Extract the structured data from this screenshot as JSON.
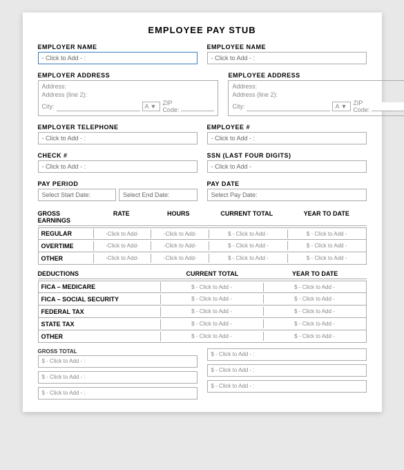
{
  "title": "EMPLOYEE PAY STUB",
  "employer": {
    "name_label": "EMPLOYER NAME",
    "name_placeholder": "- Click to Add - :",
    "address_label": "EMPLOYER ADDRESS",
    "address_line1": "Address:",
    "address_line2": "Address (line 2):",
    "city_label": "City:",
    "state_default": "A",
    "zip_label": "ZIP Code:",
    "telephone_label": "EMPLOYER TELEPHONE",
    "telephone_placeholder": "- Click to Add - :"
  },
  "employee": {
    "name_label": "EMPLOYEE NAME",
    "name_placeholder": "- Click to Add - :",
    "address_label": "EMPLOYEE ADDRESS",
    "address_line1": "Address:",
    "address_line2": "Address (line 2):",
    "city_label": "City:",
    "state_default": "A",
    "zip_label": "ZIP Code:",
    "number_label": "EMPLOYEE #",
    "number_placeholder": "- Click to Add - :",
    "ssn_label": "SSN (LAST FOUR DIGITS)",
    "ssn_placeholder": "- Click to Add -"
  },
  "check_label": "CHECK #",
  "check_placeholder": "- Click to Add - :",
  "pay_period_label": "PAY PERIOD",
  "pay_period_start": "Select Start Date:",
  "pay_period_end": "Select End Date:",
  "pay_date_label": "PAY DATE",
  "pay_date_placeholder": "Select Pay Date:",
  "earnings": {
    "section_label": "GROSS EARNINGS",
    "rate_label": "RATE",
    "hours_label": "HOURS",
    "current_total_label": "CURRENT TOTAL",
    "year_to_date_label": "YEAR TO DATE",
    "rows": [
      {
        "label": "REGULAR",
        "rate": "-Click to Add-",
        "hours": "-Click to Add-",
        "current": "$ - Click to Add -",
        "ytd": "$ - Click to Add -"
      },
      {
        "label": "OVERTIME",
        "rate": "-Click to Add-",
        "hours": "-Click to Add-",
        "current": "$ - Click to Add -",
        "ytd": "$ - Click to Add -"
      },
      {
        "label": "OTHER",
        "rate": "-Click to Add-",
        "hours": "-Click to Add-",
        "current": "$ - Click to Add -",
        "ytd": "$ - Click to Add -"
      }
    ]
  },
  "deductions": {
    "section_label": "DEDUCTIONS",
    "current_total_label": "CURRENT TOTAL",
    "year_to_date_label": "YEAR TO DATE",
    "rows": [
      {
        "label": "FICA – MEDICARE",
        "current": "$ - Click to Add -",
        "ytd": "$ - Click to Add -"
      },
      {
        "label": "FICA – SOCIAL SECURITY",
        "current": "$ - Click to Add -",
        "ytd": "$ - Click to Add -"
      },
      {
        "label": "FEDERAL TAX",
        "current": "$ - Click to Add -",
        "ytd": "$ - Click to Add -"
      },
      {
        "label": "STATE TAX",
        "current": "$ - Click to Add -",
        "ytd": "$ - Click to Add -"
      },
      {
        "label": "OTHER",
        "current": "$ - Click to Add -",
        "ytd": "$ - Click to Add -"
      }
    ]
  },
  "totals": {
    "left": {
      "label1": "GROSS TOTAL",
      "val1": "$ - Click to Add - :",
      "label2": "",
      "val2": "$ - Click to Add - :",
      "label3": "",
      "val3": "$ - Click to Add - :"
    },
    "right": {
      "label1": "",
      "val1": "$ - Click to Add - :",
      "label2": "",
      "val2": "$ - Click to Add - :",
      "label3": "",
      "val3": "$ - Click to Add - :"
    }
  }
}
